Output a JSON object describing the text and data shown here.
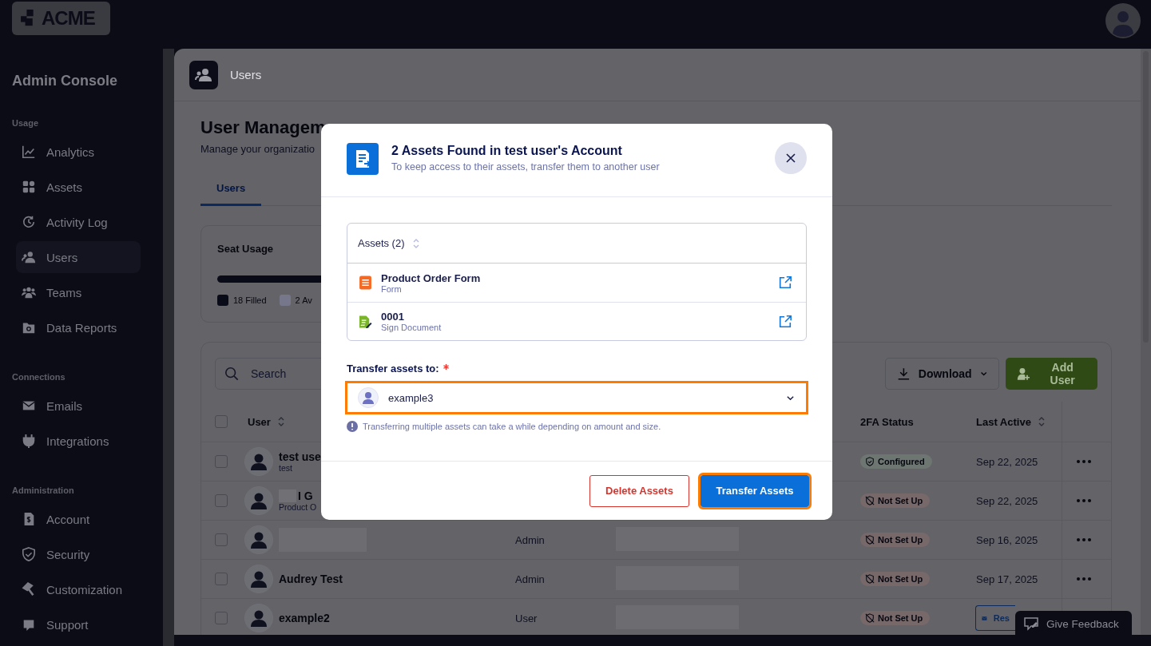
{
  "logo": {
    "text": "ACME"
  },
  "sidebar": {
    "title": "Admin Console",
    "sections": [
      {
        "heading": "Usage",
        "items": [
          {
            "label": "Analytics",
            "selected": false
          },
          {
            "label": "Assets",
            "selected": false
          },
          {
            "label": "Activity Log",
            "selected": false
          },
          {
            "label": "Users",
            "selected": true
          },
          {
            "label": "Teams",
            "selected": false
          },
          {
            "label": "Data Reports",
            "selected": false
          }
        ]
      },
      {
        "heading": "Connections",
        "items": [
          {
            "label": "Emails",
            "selected": false
          },
          {
            "label": "Integrations",
            "selected": false
          }
        ]
      },
      {
        "heading": "Administration",
        "items": [
          {
            "label": "Account",
            "selected": false
          },
          {
            "label": "Security",
            "selected": false
          },
          {
            "label": "Customization",
            "selected": false
          },
          {
            "label": "Support",
            "selected": false
          }
        ]
      }
    ]
  },
  "page_header": {
    "title": "Users"
  },
  "heading": "User Managem",
  "subtitle": "Manage your organizatio",
  "tabs": [
    {
      "label": "Users",
      "selected": true
    }
  ],
  "seat_usage": {
    "title": "Seat Usage",
    "level": 0.9,
    "legend": [
      {
        "label": "18 Filled",
        "kind": "filled"
      },
      {
        "label": "2 Av",
        "kind": "available"
      }
    ]
  },
  "toolbar": {
    "search": {
      "placeholder": "Search"
    },
    "download": "Download",
    "add_user": "Add User"
  },
  "table": {
    "select_all_checked": false,
    "columns": [
      {
        "label": "User",
        "kind": "sortable"
      },
      {
        "label": "2FA Status",
        "kind": "plain"
      },
      {
        "label": "Last Active",
        "kind": "sortable"
      }
    ],
    "rows": [
      {
        "checked": false,
        "name": "test use",
        "detail": "test",
        "name_hidden": false,
        "role": "",
        "status": "Configured",
        "configured": true,
        "last_active": "Sep 22, 2025",
        "kind": "menu"
      },
      {
        "checked": false,
        "name": "I G",
        "detail": "Product O",
        "name_hidden": true,
        "role": "",
        "status": "Not Set Up",
        "configured": false,
        "last_active": "Sep 22, 2025",
        "kind": "menu"
      },
      {
        "checked": false,
        "name": "",
        "detail": "",
        "name_hidden": true,
        "role": "Admin",
        "cell_hidden": true,
        "status": "Not Set Up",
        "configured": false,
        "last_active": "Sep 16, 2025",
        "kind": "menu"
      },
      {
        "checked": false,
        "name": "Audrey Test",
        "detail": "",
        "name_hidden": false,
        "role": "Admin",
        "cell_hidden": true,
        "status": "Not Set Up",
        "configured": false,
        "last_active": "Sep 17, 2025",
        "kind": "menu"
      },
      {
        "checked": false,
        "name": "example2",
        "detail": "",
        "name_hidden": false,
        "role": "User",
        "cell_hidden": true,
        "status": "Not Set Up",
        "configured": false,
        "last_active": "Res",
        "kind": "resend"
      }
    ]
  },
  "feedback": {
    "label": "Give Feedback"
  },
  "modal": {
    "title": "2 Assets Found in test user's Account",
    "subtitle": "To keep access to their assets, transfer them to another user",
    "assets_header": "Assets (2)",
    "assets": [
      {
        "name": "Product Order Form",
        "type": "Form",
        "kind": "form"
      },
      {
        "name": "0001",
        "type": "Sign Document",
        "kind": "sign"
      }
    ],
    "transfer_label": "Transfer assets to:",
    "required": true,
    "select": {
      "value": "example3",
      "highlighted": true
    },
    "hint": "Transferring multiple assets can take a while depending on amount and size.",
    "buttons": [
      {
        "label": "Delete Assets",
        "kind": "danger",
        "highlighted": false
      },
      {
        "label": "Transfer Assets",
        "kind": "primary",
        "highlighted": true
      }
    ]
  }
}
